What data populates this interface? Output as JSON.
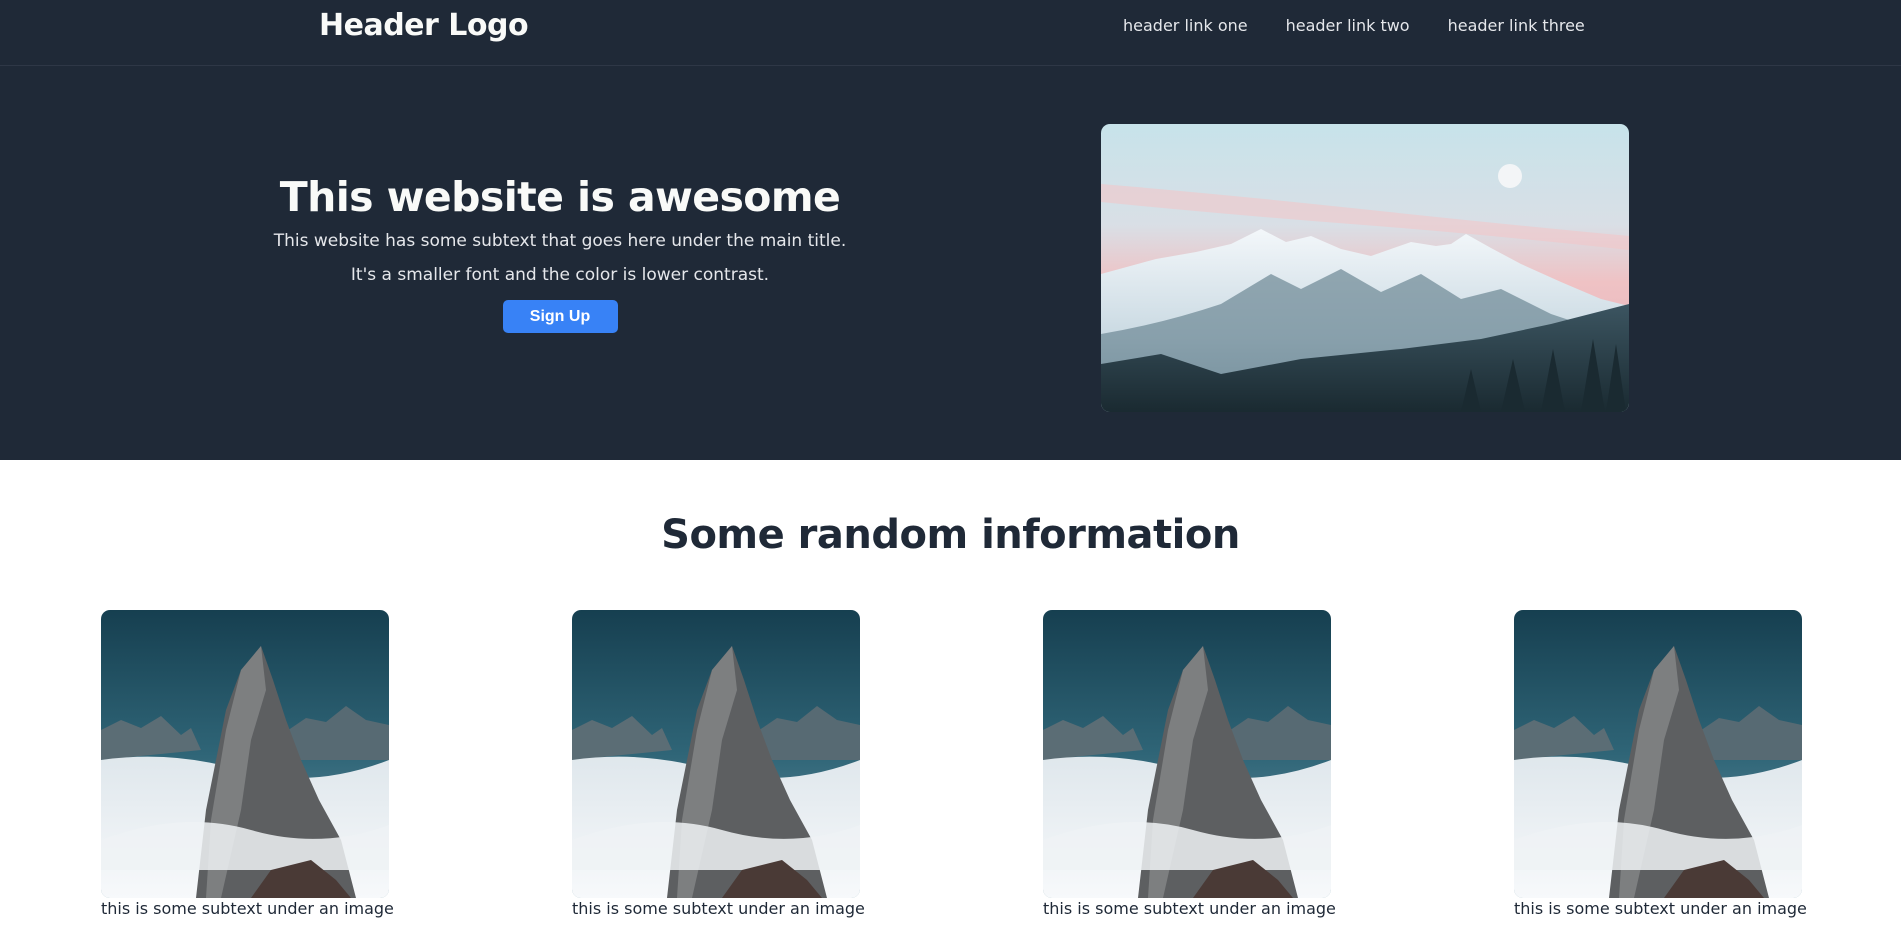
{
  "header": {
    "logo": "Header Logo",
    "links": [
      "header link one",
      "header link two",
      "header link three"
    ]
  },
  "hero": {
    "title": "This website is awesome",
    "subtext_line1": "This website has some subtext that goes here under the main title.",
    "subtext_line2": "It's a smaller font and the color is lower contrast.",
    "cta_label": "Sign Up",
    "image_icon": "mountain-landscape-image"
  },
  "info": {
    "title": "Some random information",
    "cards": [
      {
        "caption": "this is some subtext under an image",
        "image_icon": "mountain-peak-image"
      },
      {
        "caption": "this is some subtext under an image",
        "image_icon": "mountain-peak-image"
      },
      {
        "caption": "this is some subtext under an image",
        "image_icon": "mountain-peak-image"
      },
      {
        "caption": "this is some subtext under an image",
        "image_icon": "mountain-peak-image"
      }
    ]
  },
  "colors": {
    "dark_bg": "#1f2937",
    "light_text": "#f9faf8",
    "muted_text": "#e5e7eb",
    "accent": "#3882f6"
  }
}
